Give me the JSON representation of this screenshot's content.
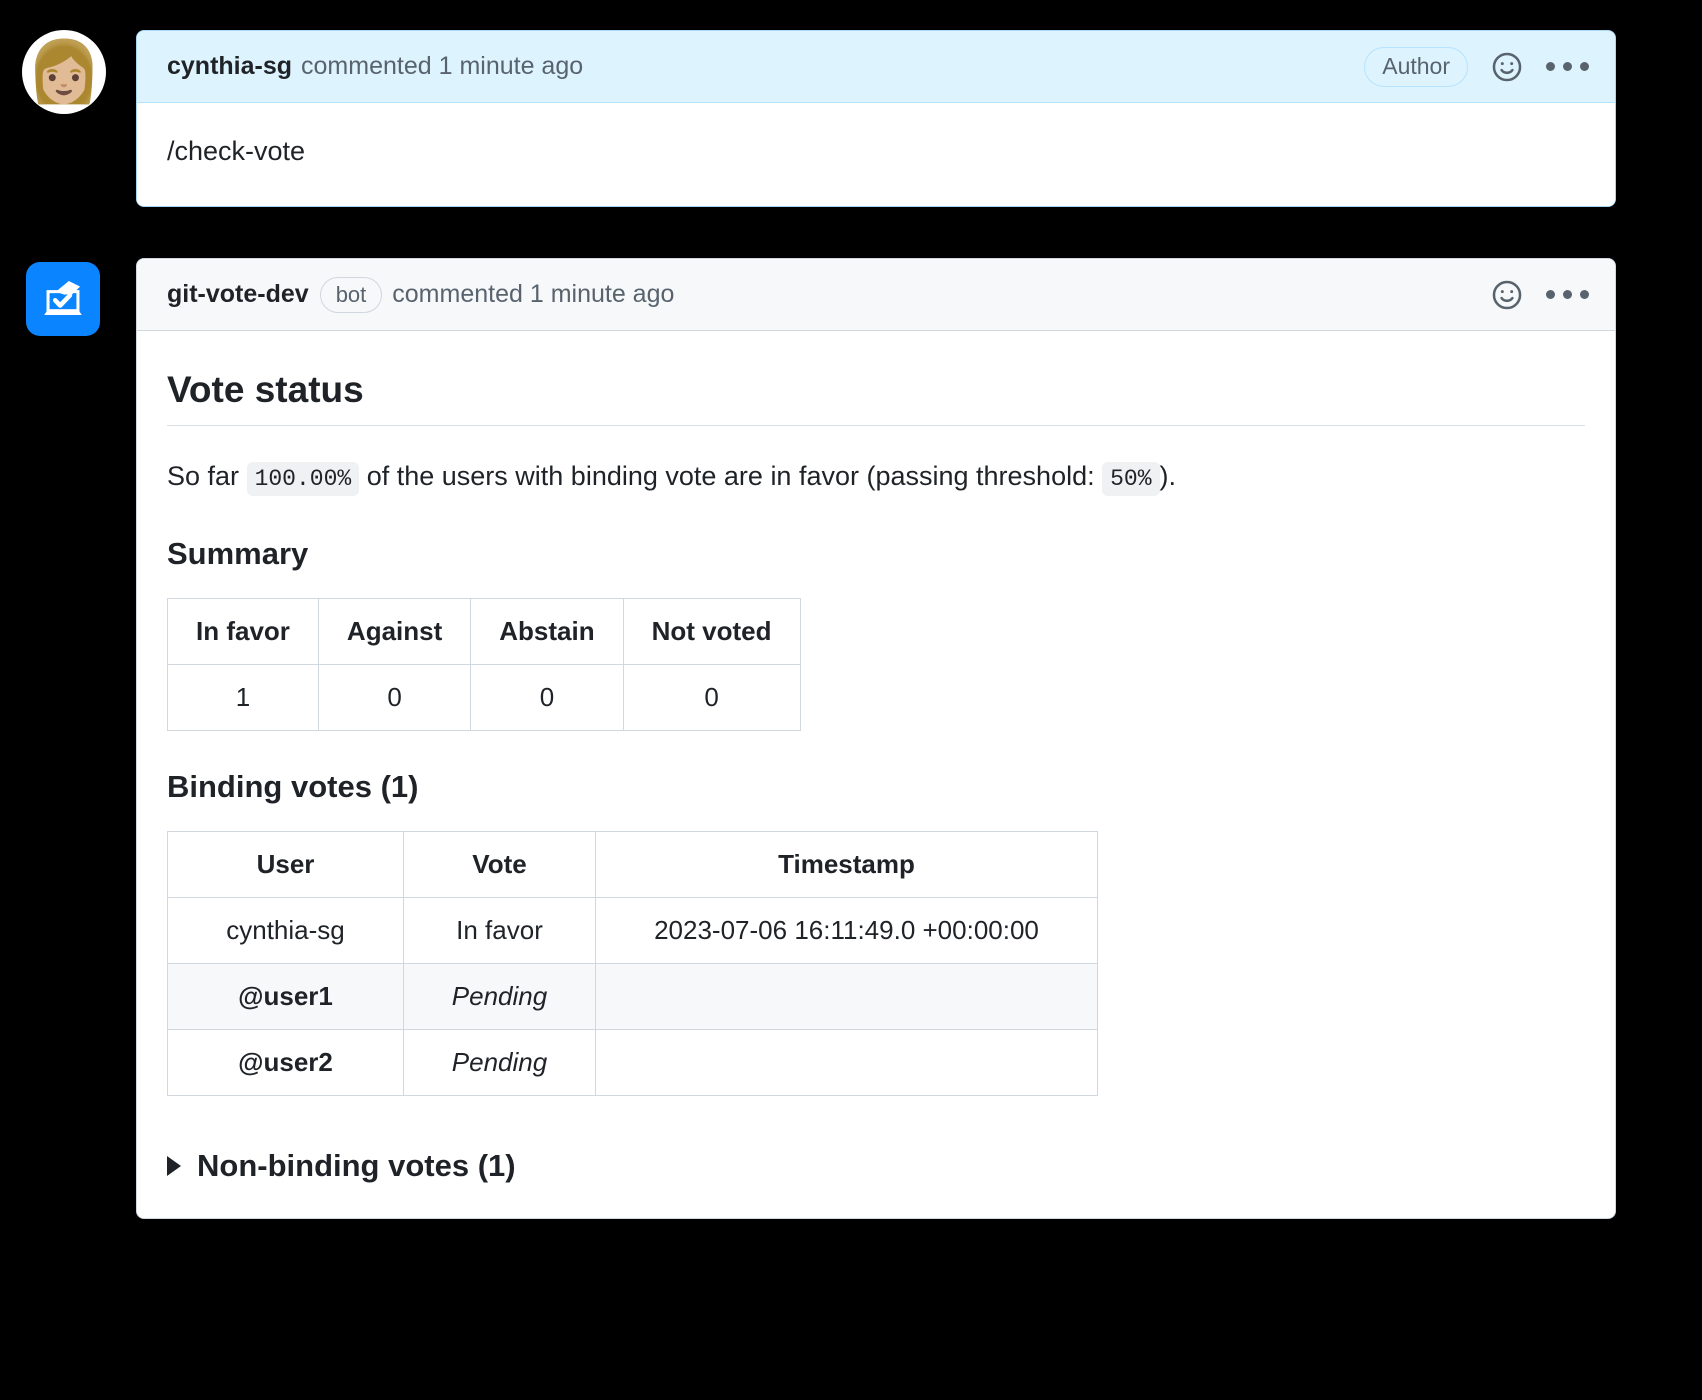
{
  "comments": [
    {
      "id": "user-comment",
      "avatar_icon": "woman-avatar-icon",
      "avatar_glyph": "👩🏼",
      "author": "cynthia-sg",
      "meta": "commented 1 minute ago",
      "badge": "Author",
      "body_text": "/check-vote",
      "reaction_icon": "smiley-icon",
      "menu_icon": "kebab-menu-icon"
    },
    {
      "id": "bot-comment",
      "avatar_icon": "ballot-box-icon",
      "author": "git-vote-dev",
      "bot_badge": "bot",
      "meta": "commented 1 minute ago",
      "reaction_icon": "smiley-icon",
      "menu_icon": "kebab-menu-icon"
    }
  ],
  "vote_status": {
    "heading": "Vote status",
    "intro": {
      "prefix": "So far",
      "percentage": "100.00%",
      "middle": "of the users with binding vote are in favor (passing threshold:",
      "threshold": "50%",
      "suffix": ")."
    },
    "summary": {
      "heading": "Summary",
      "columns": [
        "In favor",
        "Against",
        "Abstain",
        "Not voted"
      ],
      "values": [
        "1",
        "0",
        "0",
        "0"
      ]
    },
    "binding_votes": {
      "heading": "Binding votes (1)",
      "columns": [
        "User",
        "Vote",
        "Timestamp"
      ],
      "rows": [
        {
          "user": "cynthia-sg",
          "vote": "In favor",
          "timestamp": "2023-07-06 16:11:49.0 +00:00:00"
        },
        {
          "user": "@user1",
          "vote": "Pending",
          "timestamp": ""
        },
        {
          "user": "@user2",
          "vote": "Pending",
          "timestamp": ""
        }
      ]
    },
    "non_binding": {
      "label": "Non-binding votes (1)",
      "expanded": false
    }
  },
  "colors": {
    "page_background": "#000000",
    "comment_border": "#d0d7de",
    "author_header_background": "#ddf4ff",
    "bot_header_background": "#f6f8fa",
    "bot_avatar_background": "#0b84ff",
    "text_primary": "#1f2328",
    "text_muted": "#59636e"
  }
}
